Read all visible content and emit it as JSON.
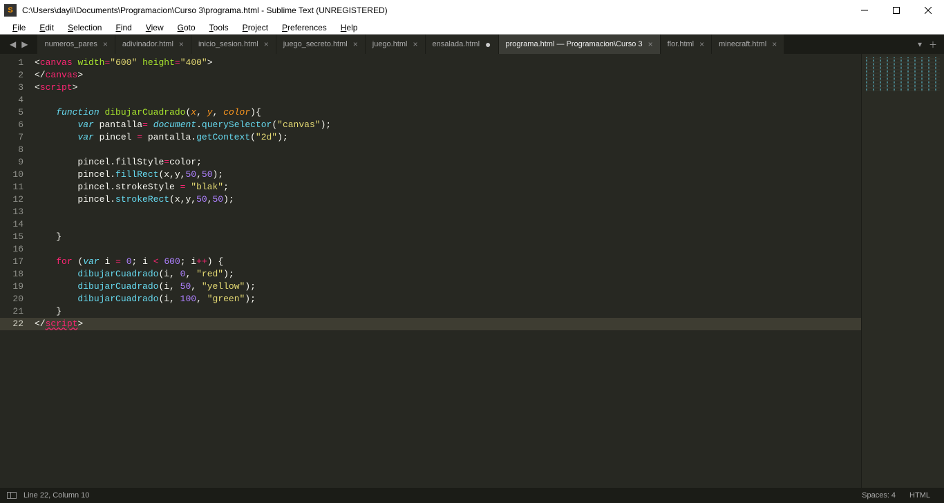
{
  "window": {
    "title": "C:\\Users\\dayli\\Documents\\Programacion\\Curso 3\\programa.html - Sublime Text (UNREGISTERED)"
  },
  "menu": {
    "items": [
      "File",
      "Edit",
      "Selection",
      "Find",
      "View",
      "Goto",
      "Tools",
      "Project",
      "Preferences",
      "Help"
    ]
  },
  "tabs": {
    "list": [
      {
        "label": "numeros_pares",
        "close": true
      },
      {
        "label": "adivinador.html",
        "close": true
      },
      {
        "label": "inicio_sesion.html",
        "close": true
      },
      {
        "label": "juego_secreto.html",
        "close": true
      },
      {
        "label": "juego.html",
        "close": true
      },
      {
        "label": "ensalada.html",
        "dirty": true
      },
      {
        "label": "programa.html — Programacion\\Curso 3",
        "close": true,
        "active": true
      },
      {
        "label": "flor.html",
        "close": true
      },
      {
        "label": "minecraft.html",
        "close": true
      }
    ]
  },
  "gutter": {
    "start": 1,
    "end": 22,
    "current": 22
  },
  "code_tokens": [
    [
      [
        "pun",
        "<"
      ],
      [
        "tag",
        "canvas"
      ],
      [
        "wh",
        " "
      ],
      [
        "attr",
        "width"
      ],
      [
        "op",
        "="
      ],
      [
        "str",
        "\"600\""
      ],
      [
        "wh",
        " "
      ],
      [
        "attr",
        "height"
      ],
      [
        "op",
        "="
      ],
      [
        "str",
        "\"400\""
      ],
      [
        "pun",
        ">"
      ]
    ],
    [
      [
        "pun",
        "</"
      ],
      [
        "tag",
        "canvas"
      ],
      [
        "pun",
        ">"
      ]
    ],
    [
      [
        "pun",
        "<"
      ],
      [
        "tag",
        "script"
      ],
      [
        "pun",
        ">"
      ]
    ],
    [],
    [
      [
        "wh",
        "    "
      ],
      [
        "kw",
        "function"
      ],
      [
        "wh",
        " "
      ],
      [
        "fn",
        "dibujarCuadrado"
      ],
      [
        "pun",
        "("
      ],
      [
        "param",
        "x"
      ],
      [
        "pun",
        ", "
      ],
      [
        "param",
        "y"
      ],
      [
        "pun",
        ", "
      ],
      [
        "param",
        "color"
      ],
      [
        "pun",
        "){"
      ]
    ],
    [
      [
        "wh",
        "        "
      ],
      [
        "kw",
        "var"
      ],
      [
        "wh",
        " "
      ],
      [
        "wh",
        "pantalla"
      ],
      [
        "op",
        "="
      ],
      [
        "wh",
        " "
      ],
      [
        "obj",
        "document"
      ],
      [
        "pun",
        "."
      ],
      [
        "call",
        "querySelector"
      ],
      [
        "pun",
        "("
      ],
      [
        "str",
        "\"canvas\""
      ],
      [
        "pun",
        ");"
      ]
    ],
    [
      [
        "wh",
        "        "
      ],
      [
        "kw",
        "var"
      ],
      [
        "wh",
        " "
      ],
      [
        "wh",
        "pincel "
      ],
      [
        "op",
        "="
      ],
      [
        "wh",
        " pantalla."
      ],
      [
        "call",
        "getContext"
      ],
      [
        "pun",
        "("
      ],
      [
        "str",
        "\"2d\""
      ],
      [
        "pun",
        ");"
      ]
    ],
    [],
    [
      [
        "wh",
        "        "
      ],
      [
        "wh",
        "pincel.fillStyle"
      ],
      [
        "op",
        "="
      ],
      [
        "wh",
        "color;"
      ]
    ],
    [
      [
        "wh",
        "        "
      ],
      [
        "wh",
        "pincel."
      ],
      [
        "call",
        "fillRect"
      ],
      [
        "pun",
        "(x,y,"
      ],
      [
        "num",
        "50"
      ],
      [
        "pun",
        ","
      ],
      [
        "num",
        "50"
      ],
      [
        "pun",
        ");"
      ]
    ],
    [
      [
        "wh",
        "        "
      ],
      [
        "wh",
        "pincel.strokeStyle "
      ],
      [
        "op",
        "="
      ],
      [
        "wh",
        " "
      ],
      [
        "str",
        "\"blak\""
      ],
      [
        "pun",
        ";"
      ]
    ],
    [
      [
        "wh",
        "        "
      ],
      [
        "wh",
        "pincel."
      ],
      [
        "call",
        "strokeRect"
      ],
      [
        "pun",
        "(x,y,"
      ],
      [
        "num",
        "50"
      ],
      [
        "pun",
        ","
      ],
      [
        "num",
        "50"
      ],
      [
        "pun",
        ");"
      ]
    ],
    [],
    [],
    [
      [
        "wh",
        "    "
      ],
      [
        "pun",
        "}"
      ]
    ],
    [],
    [
      [
        "wh",
        "    "
      ],
      [
        "kw2",
        "for"
      ],
      [
        "wh",
        " "
      ],
      [
        "pun",
        "("
      ],
      [
        "kw",
        "var"
      ],
      [
        "wh",
        " i "
      ],
      [
        "op",
        "="
      ],
      [
        "wh",
        " "
      ],
      [
        "num",
        "0"
      ],
      [
        "pun",
        "; i "
      ],
      [
        "op",
        "<"
      ],
      [
        "wh",
        " "
      ],
      [
        "num",
        "600"
      ],
      [
        "pun",
        "; i"
      ],
      [
        "op",
        "++"
      ],
      [
        "pun",
        ") {"
      ]
    ],
    [
      [
        "wh",
        "        "
      ],
      [
        "call",
        "dibujarCuadrado"
      ],
      [
        "pun",
        "(i, "
      ],
      [
        "num",
        "0"
      ],
      [
        "pun",
        ", "
      ],
      [
        "str",
        "\"red\""
      ],
      [
        "pun",
        ");"
      ]
    ],
    [
      [
        "wh",
        "        "
      ],
      [
        "call",
        "dibujarCuadrado"
      ],
      [
        "pun",
        "(i, "
      ],
      [
        "num",
        "50"
      ],
      [
        "pun",
        ", "
      ],
      [
        "str",
        "\"yellow\""
      ],
      [
        "pun",
        ");"
      ]
    ],
    [
      [
        "wh",
        "        "
      ],
      [
        "call",
        "dibujarCuadrado"
      ],
      [
        "pun",
        "(i, "
      ],
      [
        "num",
        "100"
      ],
      [
        "pun",
        ", "
      ],
      [
        "str",
        "\"green\""
      ],
      [
        "pun",
        ");"
      ]
    ],
    [
      [
        "wh",
        "    "
      ],
      [
        "pun",
        "}"
      ]
    ],
    [
      [
        "pun",
        "</"
      ],
      [
        "tag_err",
        "script"
      ],
      [
        "pun",
        ">"
      ]
    ]
  ],
  "status": {
    "position": "Line 22, Column 10",
    "spaces": "Spaces: 4",
    "syntax": "HTML"
  }
}
